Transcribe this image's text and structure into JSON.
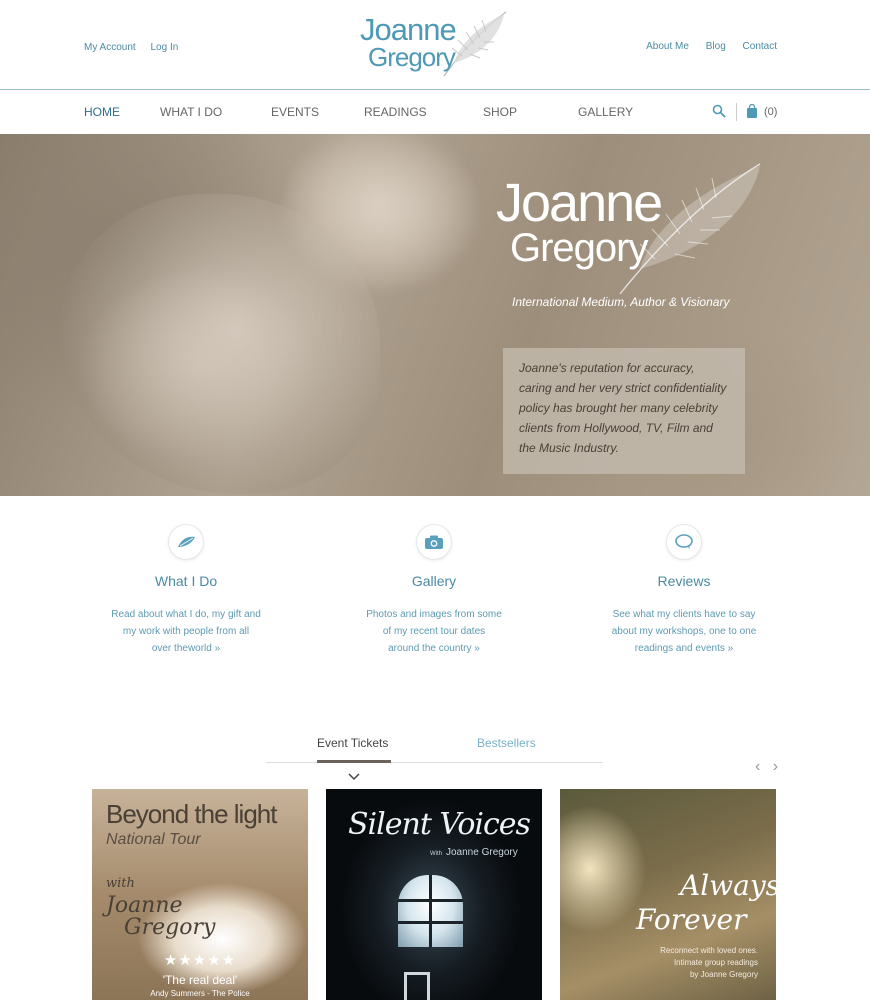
{
  "account": {
    "my_account": "My Account",
    "login": "Log In"
  },
  "logo": {
    "line1": "Joanne",
    "line2": "Gregory"
  },
  "toplinks": [
    "About Me",
    "Blog",
    "Contact"
  ],
  "nav": {
    "items": [
      "HOME",
      "WHAT I DO",
      "EVENTS",
      "READINGS",
      "SHOP",
      "GALLERY"
    ],
    "active": "HOME",
    "cart_count": "(0)"
  },
  "hero": {
    "title1": "Joanne",
    "title2": "Gregory",
    "tagline": "International Medium, Author & Visionary",
    "quote": "Joanne's reputation for accuracy, caring and her very strict confidentiality policy has brought her many celebrity clients from Hollywood, TV, Film and the Music Industry."
  },
  "features": [
    {
      "title": "What I Do",
      "icon": "feather-icon",
      "desc1": "Read about what I do, my gift and",
      "desc2": "my work with people from all",
      "desc3": "over theworld  »"
    },
    {
      "title": "Gallery",
      "icon": "camera-icon",
      "desc1": "Photos and images from some",
      "desc2": "of my recent tour dates",
      "desc3": "around the country  »"
    },
    {
      "title": "Reviews",
      "icon": "speech-bubble-icon",
      "desc1": "See what my clients have to say",
      "desc2": "about my workshops, one to one",
      "desc3": "readings and events  »"
    }
  ],
  "tabs": {
    "event_tickets": "Event Tickets",
    "bestsellers": "Bestsellers"
  },
  "carousel": {
    "prev": "‹",
    "next": "›"
  },
  "cards": [
    {
      "title": "Beyond the light",
      "subtitle": "National Tour",
      "with_line1": "with",
      "with_line2": "Joanne",
      "with_line3": "Gregory",
      "stars": "★★★★★",
      "quote": "'The real deal'",
      "quote_author": "Andy Summers - The Police"
    },
    {
      "title": "Silent Voices",
      "with": "With",
      "author": "Joanne Gregory"
    },
    {
      "title1": "Always",
      "title2": "Forever",
      "desc1": "Reconnect with loved ones.",
      "desc2": "Intimate group readings",
      "desc3": "by Joanne Gregory"
    }
  ],
  "colors": {
    "accent": "#4b8ba3",
    "accent_light": "#7ab1c6",
    "tab_underline": "#6b6359"
  }
}
